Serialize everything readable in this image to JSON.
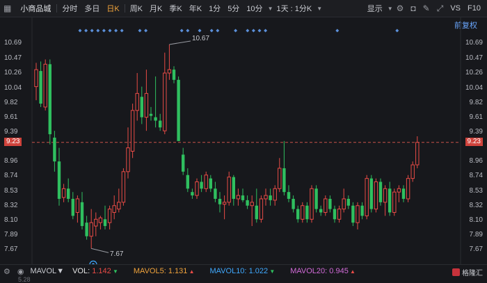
{
  "toolbar": {
    "stock_name": "小商品城",
    "periods": [
      "分时",
      "多日",
      "日K",
      "周K",
      "月K",
      "季K",
      "年K",
      "1分",
      "5分",
      "10分",
      "1天 : 1分K"
    ],
    "active_period": "日K",
    "display_label": "显示",
    "right_labels": [
      "VS",
      "F10"
    ]
  },
  "fuquan_label": "前复权",
  "price_axis": [
    "10.69",
    "10.47",
    "10.26",
    "10.04",
    "9.82",
    "9.61",
    "9.39",
    "9.23",
    "8.96",
    "8.74",
    "8.53",
    "8.32",
    "8.10",
    "7.89",
    "7.67"
  ],
  "current_price": "9.23",
  "high_marker": "10.67",
  "low_marker": "7.67",
  "volume_bar": {
    "indicator": "MAVOL",
    "vol_label": "VOL:",
    "vol_value": "1.142",
    "vol_dir": "down",
    "ma5_label": "MAVOL5:",
    "ma5_value": "1.131",
    "ma5_dir": "up",
    "ma10_label": "MAVOL10:",
    "ma10_value": "1.022",
    "ma10_dir": "down",
    "ma20_label": "MAVOL20:",
    "ma20_value": "0.945",
    "ma20_dir": "up"
  },
  "bottom_axis_value": "5.28",
  "brand_label": "格隆汇",
  "colors": {
    "up": "#e84b46",
    "down": "#2fbf5f",
    "background": "#17181c",
    "active": "#f0a33b",
    "dash": "#c9524a"
  },
  "chart_data": {
    "type": "candlestick",
    "ylim": [
      7.55,
      10.78
    ],
    "candles": [
      {
        "o": 10.05,
        "h": 10.4,
        "l": 9.85,
        "c": 10.3
      },
      {
        "o": 10.28,
        "h": 10.42,
        "l": 9.75,
        "c": 9.8
      },
      {
        "o": 9.75,
        "h": 10.45,
        "l": 9.7,
        "c": 10.38
      },
      {
        "o": 10.38,
        "h": 10.45,
        "l": 9.2,
        "c": 9.35
      },
      {
        "o": 9.3,
        "h": 9.4,
        "l": 8.8,
        "c": 8.95
      },
      {
        "o": 8.95,
        "h": 9.15,
        "l": 8.3,
        "c": 8.4
      },
      {
        "o": 8.42,
        "h": 8.62,
        "l": 8.35,
        "c": 8.55
      },
      {
        "o": 8.55,
        "h": 8.7,
        "l": 8.35,
        "c": 8.4
      },
      {
        "o": 8.4,
        "h": 8.5,
        "l": 8.1,
        "c": 8.15
      },
      {
        "o": 8.2,
        "h": 8.45,
        "l": 8.05,
        "c": 8.4
      },
      {
        "o": 8.35,
        "h": 8.5,
        "l": 7.95,
        "c": 8.0
      },
      {
        "o": 8.05,
        "h": 8.15,
        "l": 7.8,
        "c": 7.85
      },
      {
        "o": 7.85,
        "h": 8.25,
        "l": 7.67,
        "c": 8.05
      },
      {
        "o": 8.0,
        "h": 8.2,
        "l": 7.85,
        "c": 8.1
      },
      {
        "o": 8.05,
        "h": 8.15,
        "l": 7.95,
        "c": 8.12
      },
      {
        "o": 8.1,
        "h": 8.3,
        "l": 7.95,
        "c": 8.0
      },
      {
        "o": 8.05,
        "h": 8.3,
        "l": 7.95,
        "c": 8.25
      },
      {
        "o": 8.2,
        "h": 8.45,
        "l": 8.1,
        "c": 8.3
      },
      {
        "o": 8.25,
        "h": 8.55,
        "l": 8.2,
        "c": 8.35
      },
      {
        "o": 8.35,
        "h": 8.85,
        "l": 8.3,
        "c": 8.8
      },
      {
        "o": 8.8,
        "h": 9.45,
        "l": 8.7,
        "c": 9.15
      },
      {
        "o": 9.1,
        "h": 9.8,
        "l": 9.0,
        "c": 9.7
      },
      {
        "o": 9.7,
        "h": 10.25,
        "l": 9.55,
        "c": 9.95
      },
      {
        "o": 9.9,
        "h": 10.05,
        "l": 9.5,
        "c": 9.6
      },
      {
        "o": 9.6,
        "h": 10.3,
        "l": 9.4,
        "c": 9.95
      },
      {
        "o": 9.65,
        "h": 9.75,
        "l": 9.55,
        "c": 9.62
      },
      {
        "o": 9.6,
        "h": 10.2,
        "l": 9.45,
        "c": 9.55
      },
      {
        "o": 9.55,
        "h": 9.65,
        "l": 9.4,
        "c": 9.45
      },
      {
        "o": 9.4,
        "h": 10.55,
        "l": 9.35,
        "c": 10.25
      },
      {
        "o": 10.25,
        "h": 10.67,
        "l": 10.15,
        "c": 10.3
      },
      {
        "o": 10.3,
        "h": 10.35,
        "l": 10.1,
        "c": 10.15
      },
      {
        "o": 10.15,
        "h": 10.2,
        "l": 9.25,
        "c": 9.25
      },
      {
        "o": 9.05,
        "h": 9.15,
        "l": 8.75,
        "c": 8.8
      },
      {
        "o": 8.75,
        "h": 8.85,
        "l": 8.5,
        "c": 8.55
      },
      {
        "o": 8.5,
        "h": 8.55,
        "l": 8.4,
        "c": 8.45
      },
      {
        "o": 8.45,
        "h": 8.7,
        "l": 8.4,
        "c": 8.65
      },
      {
        "o": 8.65,
        "h": 8.75,
        "l": 8.5,
        "c": 8.55
      },
      {
        "o": 8.55,
        "h": 8.8,
        "l": 8.5,
        "c": 8.75
      },
      {
        "o": 8.7,
        "h": 8.75,
        "l": 8.5,
        "c": 8.55
      },
      {
        "o": 8.55,
        "h": 8.65,
        "l": 8.35,
        "c": 8.4
      },
      {
        "o": 8.4,
        "h": 8.5,
        "l": 8.2,
        "c": 8.32
      },
      {
        "o": 8.32,
        "h": 8.45,
        "l": 8.1,
        "c": 8.35
      },
      {
        "o": 8.35,
        "h": 8.8,
        "l": 8.3,
        "c": 8.72
      },
      {
        "o": 8.72,
        "h": 8.75,
        "l": 8.3,
        "c": 8.4
      },
      {
        "o": 8.4,
        "h": 8.55,
        "l": 8.3,
        "c": 8.45
      },
      {
        "o": 8.45,
        "h": 8.55,
        "l": 8.35,
        "c": 8.38
      },
      {
        "o": 8.38,
        "h": 8.45,
        "l": 8.25,
        "c": 8.3
      },
      {
        "o": 8.3,
        "h": 8.45,
        "l": 8.0,
        "c": 8.35
      },
      {
        "o": 8.3,
        "h": 8.55,
        "l": 8.05,
        "c": 8.1
      },
      {
        "o": 8.1,
        "h": 8.45,
        "l": 8.05,
        "c": 8.4
      },
      {
        "o": 8.4,
        "h": 8.55,
        "l": 8.3,
        "c": 8.45
      },
      {
        "o": 8.45,
        "h": 8.55,
        "l": 8.3,
        "c": 8.38
      },
      {
        "o": 8.38,
        "h": 8.6,
        "l": 8.3,
        "c": 8.55
      },
      {
        "o": 8.55,
        "h": 9.0,
        "l": 8.5,
        "c": 8.85
      },
      {
        "o": 8.85,
        "h": 9.25,
        "l": 8.45,
        "c": 8.5
      },
      {
        "o": 8.5,
        "h": 8.6,
        "l": 8.35,
        "c": 8.4
      },
      {
        "o": 8.4,
        "h": 8.45,
        "l": 8.2,
        "c": 8.25
      },
      {
        "o": 8.25,
        "h": 8.3,
        "l": 8.05,
        "c": 8.1
      },
      {
        "o": 8.1,
        "h": 8.35,
        "l": 8.05,
        "c": 8.3
      },
      {
        "o": 8.3,
        "h": 8.35,
        "l": 8.05,
        "c": 8.1
      },
      {
        "o": 8.1,
        "h": 8.6,
        "l": 8.05,
        "c": 8.55
      },
      {
        "o": 8.55,
        "h": 8.6,
        "l": 8.2,
        "c": 8.25
      },
      {
        "o": 8.25,
        "h": 8.3,
        "l": 8.15,
        "c": 8.2
      },
      {
        "o": 8.2,
        "h": 8.45,
        "l": 8.15,
        "c": 8.4
      },
      {
        "o": 8.4,
        "h": 8.45,
        "l": 8.2,
        "c": 8.25
      },
      {
        "o": 8.25,
        "h": 8.3,
        "l": 8.05,
        "c": 8.1
      },
      {
        "o": 8.1,
        "h": 8.3,
        "l": 8.05,
        "c": 8.25
      },
      {
        "o": 8.25,
        "h": 8.55,
        "l": 8.2,
        "c": 8.4
      },
      {
        "o": 8.4,
        "h": 8.45,
        "l": 8.25,
        "c": 8.3
      },
      {
        "o": 8.3,
        "h": 8.35,
        "l": 8.0,
        "c": 8.05
      },
      {
        "o": 8.05,
        "h": 8.35,
        "l": 7.95,
        "c": 8.3
      },
      {
        "o": 8.3,
        "h": 8.35,
        "l": 8.1,
        "c": 8.15
      },
      {
        "o": 8.15,
        "h": 8.75,
        "l": 8.1,
        "c": 8.7
      },
      {
        "o": 8.7,
        "h": 8.75,
        "l": 8.2,
        "c": 8.25
      },
      {
        "o": 8.25,
        "h": 8.7,
        "l": 8.2,
        "c": 8.65
      },
      {
        "o": 8.65,
        "h": 8.7,
        "l": 8.3,
        "c": 8.35
      },
      {
        "o": 8.35,
        "h": 8.6,
        "l": 8.15,
        "c": 8.55
      },
      {
        "o": 8.55,
        "h": 8.65,
        "l": 8.15,
        "c": 8.2
      },
      {
        "o": 8.2,
        "h": 8.55,
        "l": 8.15,
        "c": 8.5
      },
      {
        "o": 8.5,
        "h": 8.6,
        "l": 8.35,
        "c": 8.55
      },
      {
        "o": 8.55,
        "h": 8.6,
        "l": 8.35,
        "c": 8.4
      },
      {
        "o": 8.4,
        "h": 8.75,
        "l": 8.35,
        "c": 8.7
      },
      {
        "o": 8.7,
        "h": 8.95,
        "l": 8.65,
        "c": 8.9
      },
      {
        "o": 8.9,
        "h": 9.32,
        "l": 8.85,
        "c": 9.23
      }
    ],
    "dot_marker_indices": [
      10,
      12,
      14,
      16,
      18,
      20,
      22,
      24,
      30,
      32,
      44,
      46,
      50,
      54,
      56,
      62,
      66,
      68,
      70,
      72,
      96,
      116
    ]
  }
}
